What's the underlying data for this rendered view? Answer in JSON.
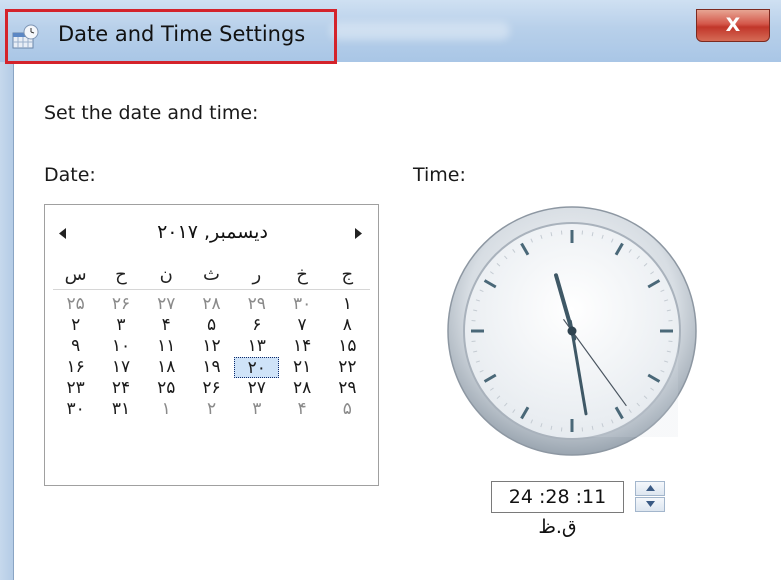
{
  "window": {
    "title": "Date and Time Settings",
    "close_label": "X",
    "icon": "date-time-app-icon",
    "highlight_color": "#d4232b"
  },
  "heading": "Set the date and time:",
  "date_label": "Date:",
  "time_label": "Time:",
  "calendar": {
    "prev_icon": "triangle-left-icon",
    "next_icon": "triangle-right-icon",
    "month_title": "دیسمبر, ۲۰۱۷",
    "weekdays": [
      "ج",
      "خ",
      "ر",
      "ث",
      "ن",
      "ح",
      "س"
    ],
    "weeks": [
      [
        "۱",
        "۳۰",
        "۲۹",
        "۲۸",
        "۲۷",
        "۲۶",
        "۲۵"
      ],
      [
        "۸",
        "۷",
        "۶",
        "۵",
        "۴",
        "۳",
        "۲"
      ],
      [
        "۱۵",
        "۱۴",
        "۱۳",
        "۱۲",
        "۱۱",
        "۱۰",
        "۹"
      ],
      [
        "۲۲",
        "۲۱",
        "۲۰",
        "۱۹",
        "۱۸",
        "۱۷",
        "۱۶"
      ],
      [
        "۲۹",
        "۲۸",
        "۲۷",
        "۲۶",
        "۲۵",
        "۲۴",
        "۲۳"
      ],
      [
        "۵",
        "۴",
        "۳",
        "۲",
        "۱",
        "۳۱",
        "۳۰"
      ]
    ],
    "other_month": [
      [
        false,
        true,
        true,
        true,
        true,
        true,
        true
      ],
      [
        false,
        false,
        false,
        false,
        false,
        false,
        false
      ],
      [
        false,
        false,
        false,
        false,
        false,
        false,
        false
      ],
      [
        false,
        false,
        false,
        false,
        false,
        false,
        false
      ],
      [
        false,
        false,
        false,
        false,
        false,
        false,
        false
      ],
      [
        true,
        true,
        true,
        true,
        true,
        false,
        false
      ]
    ],
    "selected": "۲۰"
  },
  "clock": {
    "hour": 11,
    "minute": 28,
    "second": 24
  },
  "time_field": {
    "value": "11: 28: 24 ق.ظ",
    "spin_up_icon": "chevron-up-icon",
    "spin_down_icon": "chevron-down-icon"
  }
}
